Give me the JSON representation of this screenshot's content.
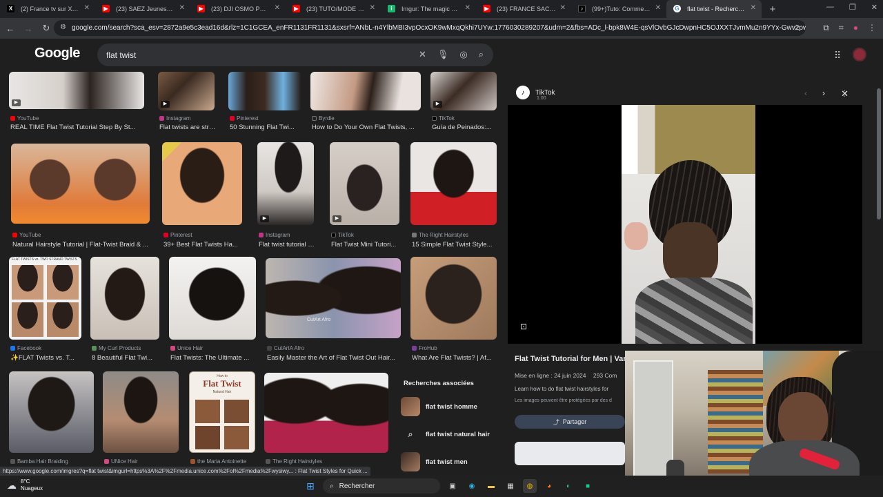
{
  "browser": {
    "tabs": [
      {
        "label": "(2) France tv sur X : \"La Rel",
        "favicon": "X",
        "color": "#000000"
      },
      {
        "label": "(23) SAEZ Jeunesse lève-t",
        "favicon": "▶",
        "color": "#ff0000"
      },
      {
        "label": "(23) DJI OSMO POCKET 3",
        "favicon": "▶",
        "color": "#ff0000"
      },
      {
        "label": "(23) TUTO/MODE D'EMPL",
        "favicon": "▶",
        "color": "#ff0000"
      },
      {
        "label": "Imgur: The magic of the I",
        "favicon": "i",
        "color": "#1bb76e"
      },
      {
        "label": "(23) FRANCE SACCAGÉE :",
        "favicon": "▶",
        "color": "#ff0000"
      },
      {
        "label": "(99+)Tuto: Comment stre",
        "favicon": "♪",
        "color": "#000000"
      },
      {
        "label": "flat twist - Recherche Goo",
        "favicon": "G",
        "color": "#4285f4",
        "active": true
      }
    ],
    "url": "google.com/search?sca_esv=2872a9e5c3ead16d&rlz=1C1GCEA_enFR1131FR1131&sxsrf=ANbL-n4YlbMBI3vpOcxOK9wMxqQkhi7UYw:1776030289207&udm=2&fbs=ADc_l-bpk8W4E-qsVlOvbGJcDwpnHC5OJXXTJvmMu2n9YYx-Gwv2pwuu9X9wxEE6t..."
  },
  "google": {
    "logo": "Google",
    "query": "flat twist"
  },
  "results": {
    "row1": [
      {
        "source": "YouTube",
        "title": "REAL TIME Flat Twist Tutorial Step By St...",
        "src_color": "#ff0000",
        "video": true
      },
      {
        "source": "Instagram",
        "title": "Flat twists are strat...",
        "src_color": "#c13584",
        "video": true
      },
      {
        "source": "Pinterest",
        "title": "50 Stunning Flat Twi...",
        "src_color": "#e60023"
      },
      {
        "source": "Byrdie",
        "title": "How to Do Your Own Flat Twists, ...",
        "src_color": "#222222"
      },
      {
        "source": "TikTok",
        "title": "Guía de Peinados:...",
        "src_color": "#000000",
        "video": true
      }
    ],
    "row2": [
      {
        "source": "YouTube",
        "title": "Natural Hairstyle Tutorial | Flat-Twist Braid & ...",
        "src_color": "#ff0000"
      },
      {
        "source": "Pinterest",
        "title": "39+ Best Flat Twists Ha...",
        "src_color": "#e60023"
      },
      {
        "source": "Instagram",
        "title": "Flat twist tutorial o...",
        "src_color": "#c13584",
        "video": true
      },
      {
        "source": "TikTok",
        "title": "Flat Twist Mini Tutori...",
        "src_color": "#000000",
        "video": true
      },
      {
        "source": "The Right Hairstyles",
        "title": "15 Simple Flat Twist Style...",
        "src_color": "#555555"
      }
    ],
    "row3": [
      {
        "source": "Facebook",
        "title": "✨FLAT Twists vs. T...",
        "src_color": "#1877f2",
        "overlay": "FLAT TWISTS vs. TWO STRAND TWISTS"
      },
      {
        "source": "My Curl Products",
        "title": "8 Beautiful Flat Twi...",
        "src_color": "#5a8f5a"
      },
      {
        "source": "Unice Hair",
        "title": "Flat Twists: The Ultimate ...",
        "src_color": "#d4477f"
      },
      {
        "source": "CutArtA Afro",
        "title": "Easily Master the Art of Flat Twist Out Hair...",
        "src_color": "#444444",
        "overlay": "CutArt Afro"
      },
      {
        "source": "FroHub",
        "title": "What Are Flat Twists? | Af...",
        "src_color": "#7b3fa0"
      }
    ],
    "row4": [
      {
        "source": "Bamba Hair Braiding",
        "title": "",
        "src_color": "#555555"
      },
      {
        "source": "UNice Hair",
        "title": "",
        "src_color": "#d4477f"
      },
      {
        "source": "the Maria Antoinette",
        "title": "",
        "src_color": "#a0522d",
        "poster_title": "Flat Twist",
        "poster_small": "How to",
        "poster_sub": "Natural Hair"
      },
      {
        "source": "The Right Hairstyles",
        "title": "",
        "src_color": "#555555"
      }
    ],
    "related": {
      "heading": "Recherches associées",
      "items": [
        {
          "label": "flat twist homme",
          "type": "thumb"
        },
        {
          "label": "flat twist natural hair",
          "type": "search"
        },
        {
          "label": "flat twist men",
          "type": "thumb"
        }
      ]
    }
  },
  "preview": {
    "source": "TikTok",
    "source_logo": "♪",
    "duration": "1:00",
    "title": "Flat Twist Tutorial for Men | Var",
    "meta_date": "Mise en ligne : 24 juin 2024",
    "meta_count": "293 Com",
    "description": "Learn how to do flat twist hairstyles for",
    "copyright": "Les images peuvent être protégées par des d",
    "share_label": "Partager"
  },
  "status_url": "https://www.google.com/imgres?q=flat twist&imgurl=https%3A%2F%2Fmedia.unice.com%2Fol%2Fmedia%2Fwysiwy... : Flat Twist Styles for Quick ...",
  "taskbar": {
    "temperature": "8°C",
    "weather": "Nuageux",
    "search_label": "Rechercher"
  }
}
